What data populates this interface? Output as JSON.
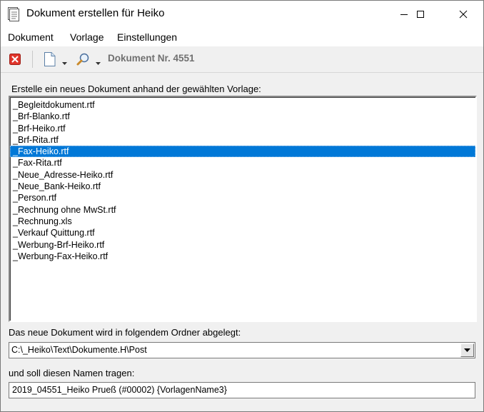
{
  "window": {
    "title": "Dokument erstellen für Heiko"
  },
  "menu": {
    "items": [
      "Dokument",
      "Vorlage",
      "Einstellungen"
    ]
  },
  "toolbar": {
    "document_number": "Dokument Nr. 4551"
  },
  "templates": {
    "label": "Erstelle ein neues Dokument anhand der gewählten Vorlage:",
    "items": [
      "_Begleitdokument.rtf",
      "_Brf-Blanko.rtf",
      "_Brf-Heiko.rtf",
      "_Brf-Rita.rtf",
      "_Fax-Heiko.rtf",
      "_Fax-Rita.rtf",
      "_Neue_Adresse-Heiko.rtf",
      "_Neue_Bank-Heiko.rtf",
      "_Person.rtf",
      "_Rechnung ohne MwSt.rtf",
      "_Rechnung.xls",
      "_Verkauf Quittung.rtf",
      "_Werbung-Brf-Heiko.rtf",
      "_Werbung-Fax-Heiko.rtf"
    ],
    "selected": "_Fax-Heiko.rtf"
  },
  "folder": {
    "label": "Das neue Dokument wird in folgendem Ordner abgelegt:",
    "value": "C:\\_Heiko\\Text\\Dokumente.H\\Post"
  },
  "filename": {
    "label": "und soll diesen Namen tragen:",
    "value": "2019_04551_Heiko Prueß (#00002) {VorlagenName3}"
  },
  "icons": {
    "app": "document-icon",
    "close_toolbar": "red-close-icon",
    "new_document": "new-document-icon",
    "search": "search-icon"
  },
  "colors": {
    "selection": "#0078d7",
    "close_red": "#e0352b",
    "doc_number_text": "#707070"
  }
}
